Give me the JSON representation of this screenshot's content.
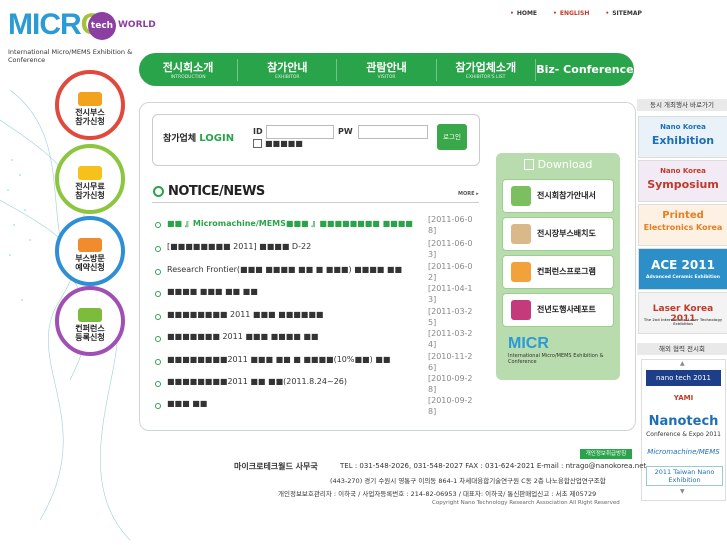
{
  "util_nav": [
    {
      "label": "HOME",
      "active": false
    },
    {
      "label": "ENGLISH",
      "active": true
    },
    {
      "label": "SITEMAP",
      "active": false
    }
  ],
  "logo": {
    "micro": "MICR",
    "o": "O",
    "tech": "tech",
    "world": "WORLD",
    "subtitle": "International Micro/MEMS Exhibition & Conference"
  },
  "nav": [
    {
      "ko": "전시회소개",
      "en": "INTRODUCTION"
    },
    {
      "ko": "참가안내",
      "en": "EXHIBITOR"
    },
    {
      "ko": "관람안내",
      "en": "VISITOR"
    },
    {
      "ko": "참가업체소개",
      "en": "EXHIBITOR'S LIST"
    },
    {
      "ko": "Biz- Conference",
      "en": ""
    }
  ],
  "left_menu": [
    {
      "label": "전시부스\n참가신청",
      "color": "#e0493b",
      "icon_color": "#f3a21d"
    },
    {
      "label": "전시무료\n참가신청",
      "color": "#8cc63f",
      "icon_color": "#f6c21a"
    },
    {
      "label": "부스방문\n예약신청",
      "color": "#2f8fd6",
      "icon_color": "#f08c2b"
    },
    {
      "label": "컨퍼런스\n등록신청",
      "color": "#a04fb5",
      "icon_color": "#7dbb3a"
    }
  ],
  "login": {
    "title_prefix": "참가업체",
    "title_main": "LOGIN",
    "id_label": "ID",
    "pw_label": "PW",
    "button": "로그인",
    "save_label": "■■■■■"
  },
  "notice": {
    "title": "NOTICE/NEWS",
    "more": "MORE ▸",
    "items": [
      {
        "text": "■■ 』Micromachine/MEMS■■■ 』■■■■■■■■ ■■■■",
        "date": "[2011-06-08]",
        "highlight": true
      },
      {
        "text": "[■■■■■■■■ 2011] ■■■■ D-22",
        "date": "[2011-06-03]",
        "highlight": false
      },
      {
        "text": "Research Frontier(■■■ ■■■■ ■■ ■ ■■■) ■■■■ ■■",
        "date": "[2011-06-02]",
        "highlight": false
      },
      {
        "text": "■■■■ ■■■ ■■ ■■",
        "date": "[2011-04-13]",
        "highlight": false
      },
      {
        "text": "■■■■■■■■ 2011 ■■■ ■■■■■■",
        "date": "[2011-03-25]",
        "highlight": false
      },
      {
        "text": "■■■■■■■ 2011 ■■■ ■■■■ ■■",
        "date": "[2011-03-24]",
        "highlight": false
      },
      {
        "text": "■■■■■■■■2011 ■■■ ■■ ■ ■■■■(10%■■) ■■",
        "date": "[2010-11-26]",
        "highlight": false
      },
      {
        "text": "■■■■■■■■2011 ■■ ■■(2011.8.24~26)",
        "date": "[2010-09-28]",
        "highlight": false
      },
      {
        "text": "■■■ ■■",
        "date": "[2010-09-28]",
        "highlight": false
      }
    ]
  },
  "download": {
    "title": "Download",
    "items": [
      {
        "label": "전시회참가안내서",
        "icon_color": "#7bbf5e"
      },
      {
        "label": "전시장부스배치도",
        "icon_color": "#d9b88a"
      },
      {
        "label": "컨퍼런스프로그램",
        "icon_color": "#f2a23a"
      },
      {
        "label": "전년도행사레포트",
        "icon_color": "#c43a7a"
      }
    ],
    "logo_micro": "MICR",
    "logo_sub": "International Micro/MEMS Exhibition & Conference"
  },
  "sidebar": {
    "title": "동시 개최행사 바로가기",
    "events": [
      {
        "line1": "Nano Korea",
        "line2": "Exhibition",
        "color": "#1d6fb8"
      },
      {
        "line1": "Nano Korea",
        "line2": "Symposium",
        "color": "#c0392b"
      },
      {
        "line1": "Printed",
        "line2": "Electronics Korea",
        "color": "#e67e22"
      },
      {
        "line1": "ACE 2011",
        "line2": "Advanced Ceramic Exhibition",
        "color": "#ffffff"
      },
      {
        "line1": "Laser Korea 2011",
        "line2": "The 2nd International Laser Technology Exhibition",
        "color": "#c0392b"
      }
    ],
    "partner_title": "해외 협력 전시회",
    "partners": [
      {
        "label": "nano tech 2011",
        "color": "#1d3f8a"
      },
      {
        "label": "YAMI",
        "color": "#c0392b"
      },
      {
        "label": "Nanotech",
        "color": "#1d6fb8"
      },
      {
        "label": "Conference & Expo 2011",
        "color": "#333333"
      },
      {
        "label": "Micromachine/MEMS",
        "color": "#1d6fb8"
      },
      {
        "label": "2011 Taiwan Nano Exhibition",
        "color": "#1d6fb8"
      }
    ]
  },
  "footer": {
    "privacy": "개인정보취급방침",
    "office": "마이크로테크월드 사무국",
    "contact": "TEL : 031-548-2026, 031-548-2027  FAX : 031-624-2021  E-mail : ntrago@nanokorea.net",
    "address": "(443-270) 경기 수원시 영통구 이의동 864-1 차세대융합기술연구원 C동 2층 나노융합산업연구조합",
    "registration": "개인정보보호관리자 : 이하국 / 사업자등록번호 : 214-82-06953 / 대표자: 이하국/ 통신판매업신고 : 서초 제05729",
    "copyright": "Copyright Nano Technology Research Association All Right Reserved"
  },
  "colors": {
    "brand_green": "#2aa44a",
    "brand_blue": "#2b9bd6",
    "brand_purple": "#8b3fa0"
  }
}
